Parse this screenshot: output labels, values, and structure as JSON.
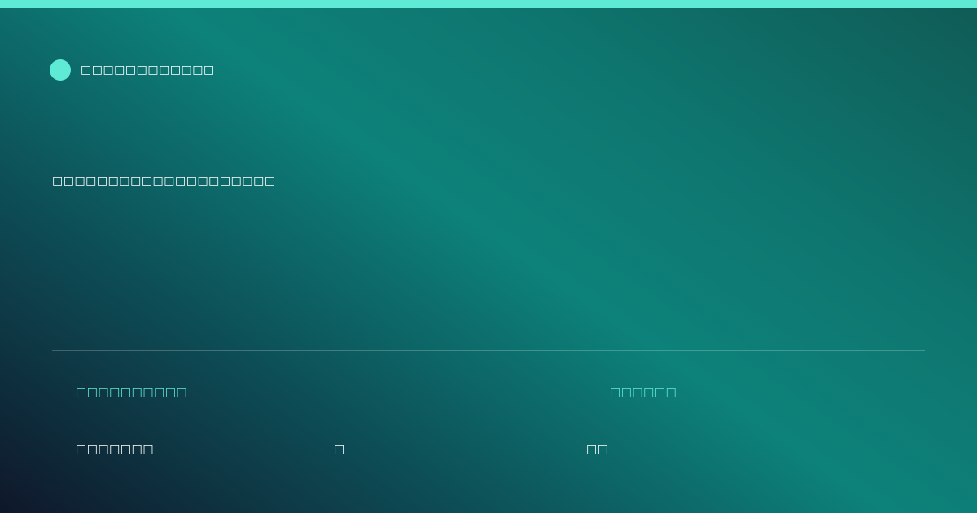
{
  "colors": {
    "accent": "#5eead4",
    "background_start": "#0f172a",
    "background_mid": "#0d827a",
    "background_end": "#105b56",
    "text": "#ffffff"
  },
  "brand": {
    "name": "□□□□□□□□□□□□"
  },
  "headline": "□□□□□□□□□□□□□□□□□□□□",
  "footer": {
    "left_label": "□□□□□□□□□□",
    "right_label": "□□□□□□",
    "values": [
      "□□□□□□□",
      "□",
      "□□"
    ]
  }
}
